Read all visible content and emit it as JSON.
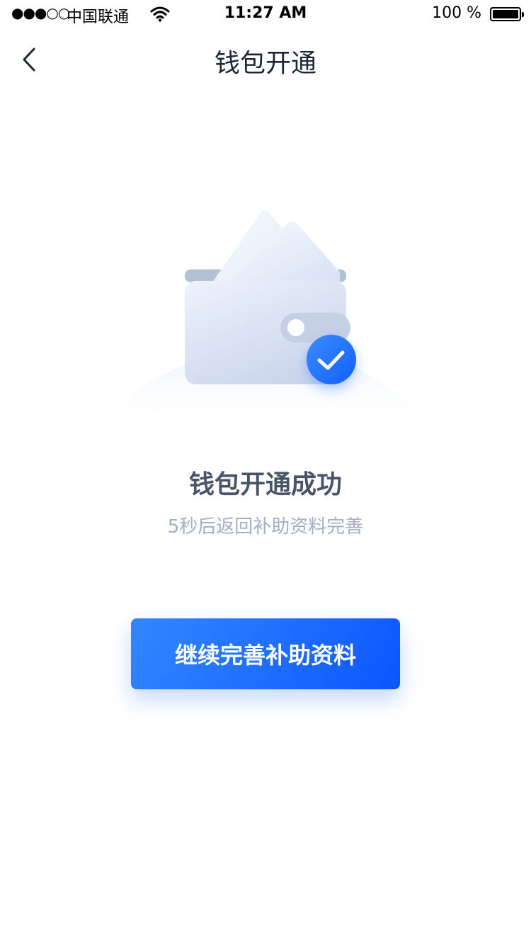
{
  "status_bar": {
    "signal": "●●●○○",
    "carrier": "中国联通",
    "time": "11:27 AM",
    "battery_text": "100 %",
    "wifi_icon": "wifi-icon",
    "battery_icon": "battery-icon",
    "battery_level": 1.0
  },
  "nav": {
    "title": "钱包开通",
    "back_icon": "chevron-left-icon"
  },
  "illustration": {
    "icon": "wallet-icon",
    "badge_icon": "check-icon",
    "badge_color": "#2d7bff"
  },
  "result": {
    "title": "钱包开通成功",
    "subtitle": "5秒后返回补助资料完善"
  },
  "actions": {
    "continue_label": "继续完善补助资料"
  },
  "colors": {
    "accent": "#1f6dff",
    "title_text": "#4a5468",
    "subtitle_text": "#a4aec4"
  }
}
